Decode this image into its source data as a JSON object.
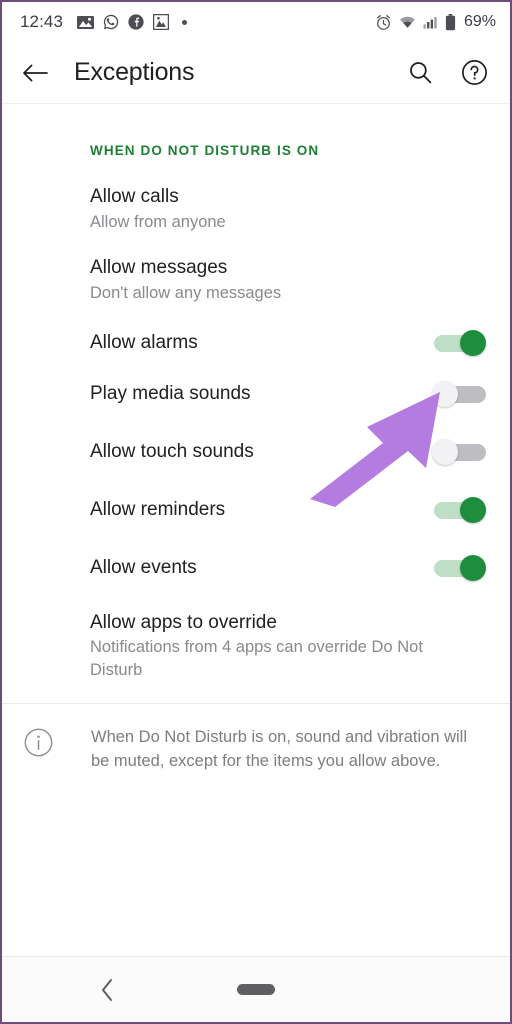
{
  "status_bar": {
    "time": "12:43",
    "left_icons": [
      "photo-icon",
      "whatsapp-icon",
      "facebook-icon",
      "gallery-icon",
      "dot-indicator"
    ],
    "right_icons": [
      "alarm-icon",
      "wifi-icon",
      "signal-icon",
      "battery-icon"
    ],
    "battery_percent": "69%"
  },
  "app_bar": {
    "back_icon": "back-arrow-icon",
    "title": "Exceptions",
    "search_icon": "search-icon",
    "help_icon": "help-icon"
  },
  "section": {
    "header": "WHEN DO NOT DISTURB IS ON",
    "header_color": "#1e7e34"
  },
  "rows": [
    {
      "title": "Allow calls",
      "subtitle": "Allow from anyone",
      "type": "navigation"
    },
    {
      "title": "Allow messages",
      "subtitle": "Don't allow any messages",
      "type": "navigation"
    },
    {
      "title": "Allow alarms",
      "subtitle": "",
      "type": "switch",
      "state": "on"
    },
    {
      "title": "Play media sounds",
      "subtitle": "",
      "type": "switch",
      "state": "off"
    },
    {
      "title": "Allow touch sounds",
      "subtitle": "",
      "type": "switch",
      "state": "off"
    },
    {
      "title": "Allow reminders",
      "subtitle": "",
      "type": "switch",
      "state": "on"
    },
    {
      "title": "Allow events",
      "subtitle": "",
      "type": "switch",
      "state": "on"
    },
    {
      "title": "Allow apps to override",
      "subtitle": "Notifications from 4 apps can override Do Not Disturb",
      "type": "navigation"
    }
  ],
  "footer": {
    "icon": "info-icon",
    "text": "When Do Not Disturb is on, sound and vibration will be muted, except for the items you allow above."
  },
  "annotation": {
    "type": "arrow",
    "color": "#b47ce0",
    "points_at": "Allow alarms toggle"
  },
  "nav_bar": {
    "back_icon": "nav-back-chevron-icon",
    "home_pill": "home-gesture-pill"
  },
  "colors": {
    "switch_on_thumb": "#1e8e3e",
    "switch_on_track": "#bedfc6",
    "switch_off_track": "#bdbdc2",
    "switch_off_thumb": "#f2f2f4",
    "title_text": "#212121",
    "subtitle_text": "#8a8a8e"
  }
}
